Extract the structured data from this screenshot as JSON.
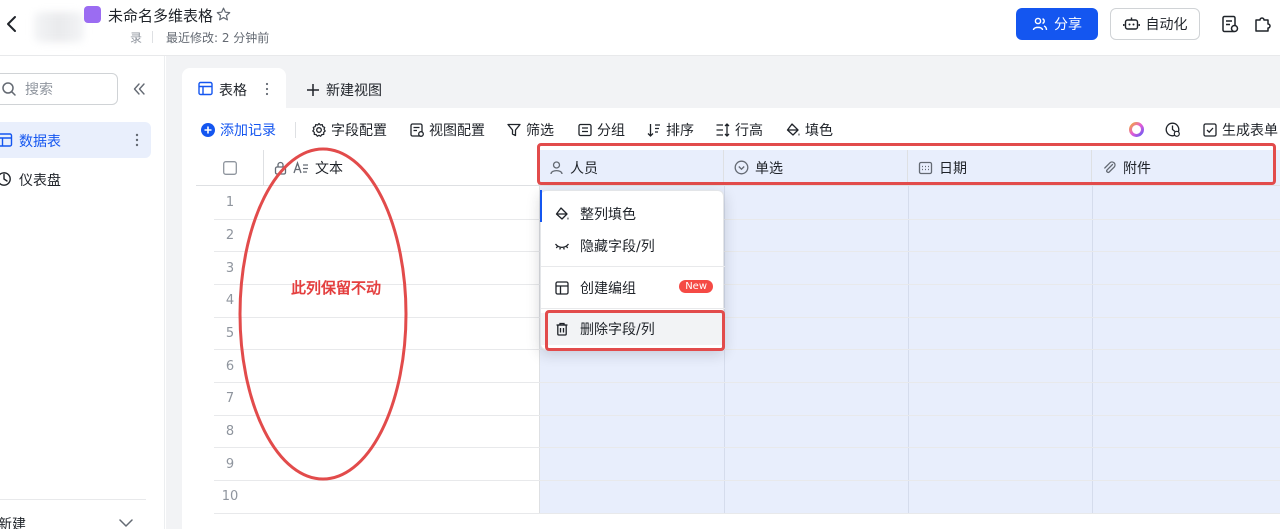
{
  "header": {
    "title": "未命名多维表格",
    "sub_fragment": "录",
    "last_modified": "最近修改: 2 分钟前",
    "share_label": "分享",
    "automation_label": "自动化"
  },
  "sidebar": {
    "search_placeholder": "搜索",
    "items": [
      {
        "label": "数据表",
        "active": true
      },
      {
        "label": "仪表盘",
        "active": false
      }
    ],
    "new_label": "新建"
  },
  "tabs": {
    "current": "表格",
    "new_view": "新建视图"
  },
  "toolbar": {
    "add_record": "添加记录",
    "field_config": "字段配置",
    "view_config": "视图配置",
    "filter": "筛选",
    "group": "分组",
    "sort": "排序",
    "row_height": "行高",
    "fill": "填色",
    "generate_form": "生成表单"
  },
  "grid": {
    "columns": [
      {
        "label": "文本",
        "icon": "text-field-icon"
      },
      {
        "label": "人员",
        "icon": "person-icon"
      },
      {
        "label": "单选",
        "icon": "single-select-icon"
      },
      {
        "label": "日期",
        "icon": "calendar-icon"
      },
      {
        "label": "附件",
        "icon": "attachment-icon"
      }
    ],
    "rows": [
      "1",
      "2",
      "3",
      "4",
      "5",
      "6",
      "7",
      "8",
      "9",
      "10"
    ]
  },
  "context_menu": {
    "items": [
      {
        "label": "整列填色",
        "icon": "fill-bucket-icon"
      },
      {
        "label": "隐藏字段/列",
        "icon": "eye-closed-icon"
      },
      {
        "label": "创建编组",
        "icon": "group-layout-icon",
        "badge": "New"
      },
      {
        "label": "删除字段/列",
        "icon": "trash-icon"
      }
    ]
  },
  "annotation": {
    "note": "此列保留不动",
    "color": "#e24b4b"
  },
  "colors": {
    "accent": "#1456f0",
    "selection": "#e8eefc",
    "annotation": "#e24b4b"
  }
}
